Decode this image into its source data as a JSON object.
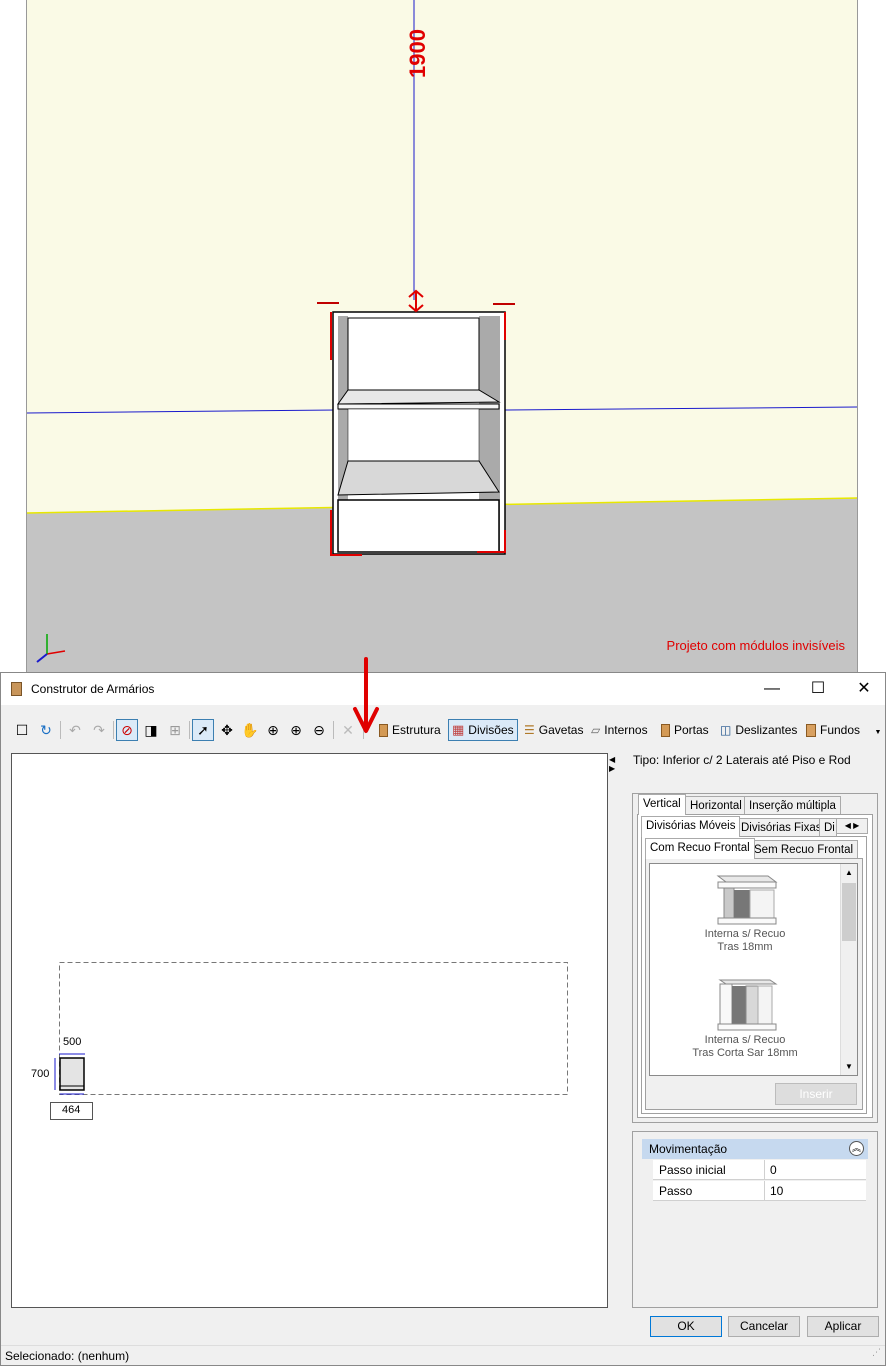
{
  "viewport": {
    "height_label": "1900",
    "invisible_note": "Projeto com módulos invisíveis"
  },
  "dialog": {
    "title": "Construtor de Armários",
    "toolbar": {
      "estrutura": "Estrutura",
      "divisoes": "Divisões",
      "gavetas": "Gavetas",
      "internos": "Internos",
      "portas": "Portas",
      "deslizantes": "Deslizantes",
      "fundos": "Fundos"
    },
    "canvas": {
      "width_label": "500",
      "height_label": "700",
      "depth_label": "464"
    },
    "tipo": "Tipo: Inferior c/ 2 Laterais até Piso e Rod",
    "tabs": {
      "vertical": "Vertical",
      "horizontal": "Horizontal",
      "insercao": "Inserção múltipla",
      "moveis": "Divisórias Móveis",
      "fixas": "Divisórias Fixas",
      "di": "Di",
      "com_recuo": "Com Recuo Frontal",
      "sem_recuo": "Sem Recuo Frontal"
    },
    "items": [
      {
        "label1": "Interna s/ Recuo",
        "label2": "Tras 18mm"
      },
      {
        "label1": "Interna s/ Recuo",
        "label2": "Tras Corta Sar 18mm"
      }
    ],
    "insert_button": "Inserir",
    "movimentacao": {
      "header": "Movimentação",
      "rows": [
        {
          "key": "Passo inicial",
          "value": "0"
        },
        {
          "key": "Passo",
          "value": "10"
        }
      ]
    },
    "buttons": {
      "ok": "OK",
      "cancel": "Cancelar",
      "apply": "Aplicar"
    },
    "status": "Selecionado: (nenhum)"
  },
  "colors": {
    "wall": "#fafae6",
    "floor": "#c4c4c4",
    "accent_red": "#e00000",
    "guide_blue": "#1a1acc",
    "selection": "#3c7fb1"
  }
}
